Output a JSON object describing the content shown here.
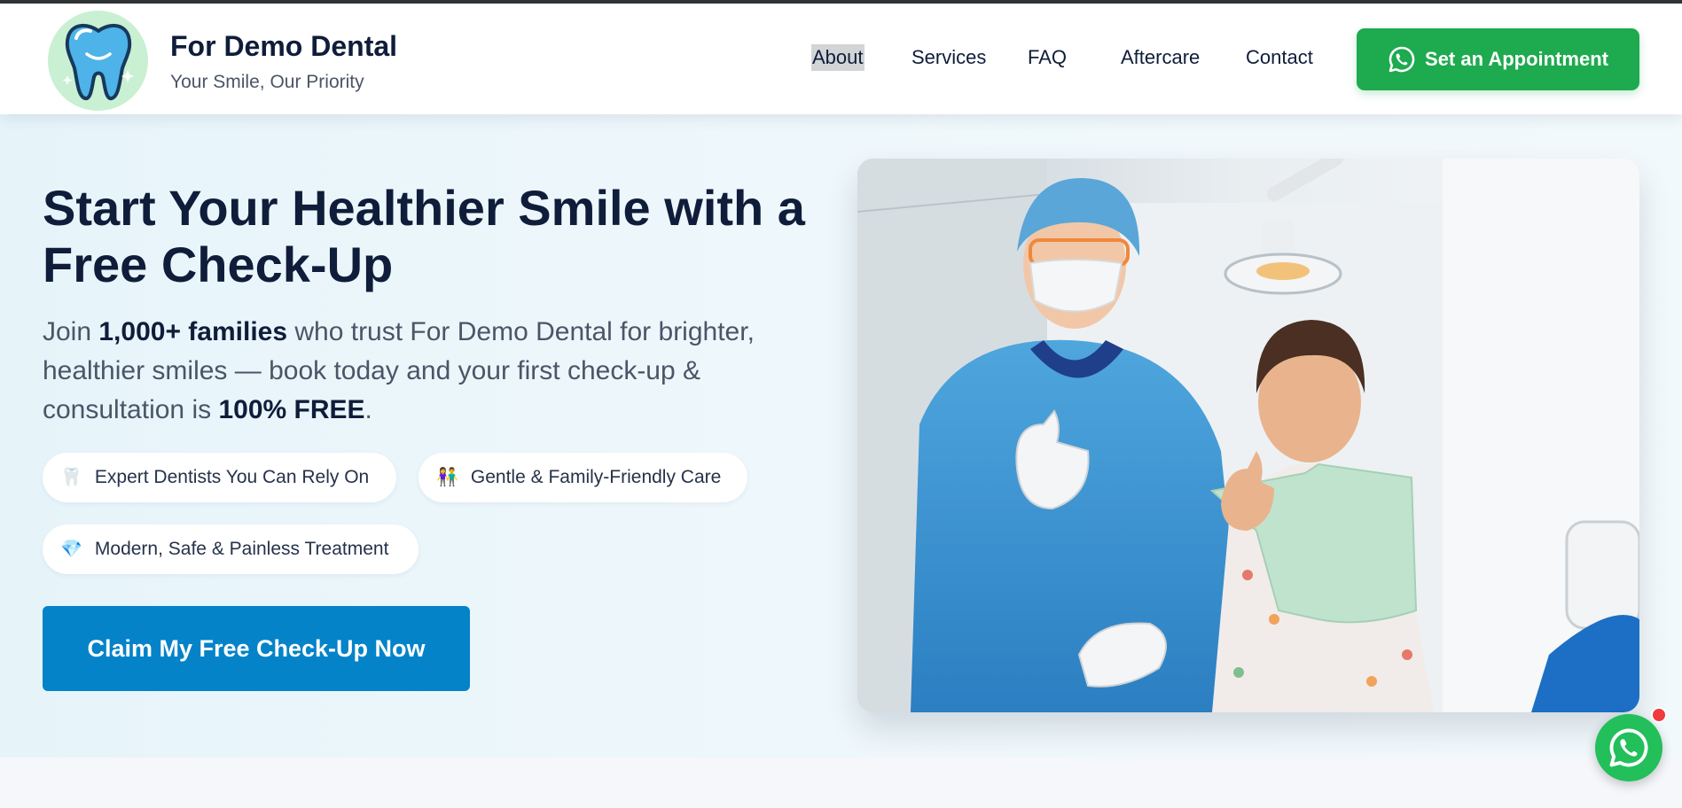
{
  "header": {
    "brand_name": "For Demo Dental",
    "tagline": "Your Smile, Our Priority",
    "nav": [
      {
        "label": "About",
        "active": true
      },
      {
        "label": "Services"
      },
      {
        "label": "FAQ"
      },
      {
        "label": "Aftercare"
      },
      {
        "label": "Contact"
      }
    ],
    "cta_label": "Set an Appointment",
    "cta_icon": "whatsapp-icon"
  },
  "hero": {
    "title": "Start Your Healthier Smile with a Free Check-Up",
    "description": {
      "part1": "Join ",
      "bold1": "1,000+ families",
      "part2": " who trust For Demo Dental for brighter, healthier smiles — book today and your first check-up & consultation is ",
      "bold2": "100% FREE",
      "part3": "."
    },
    "features": [
      {
        "icon": "tooth-icon",
        "glyph": "🦷",
        "label": "Expert Dentists You Can Rely On"
      },
      {
        "icon": "family-icon",
        "glyph": "👫",
        "label": "Gentle & Family-Friendly Care"
      },
      {
        "icon": "gem-icon",
        "glyph": "💎",
        "label": "Modern, Safe & Painless Treatment"
      }
    ],
    "cta_label": "Claim My Free Check-Up Now"
  },
  "colors": {
    "brand_green": "#1eaa4f",
    "primary_blue": "#0483c8",
    "navy_text": "#0f1d3a",
    "notification_red": "#ef3b3b"
  }
}
